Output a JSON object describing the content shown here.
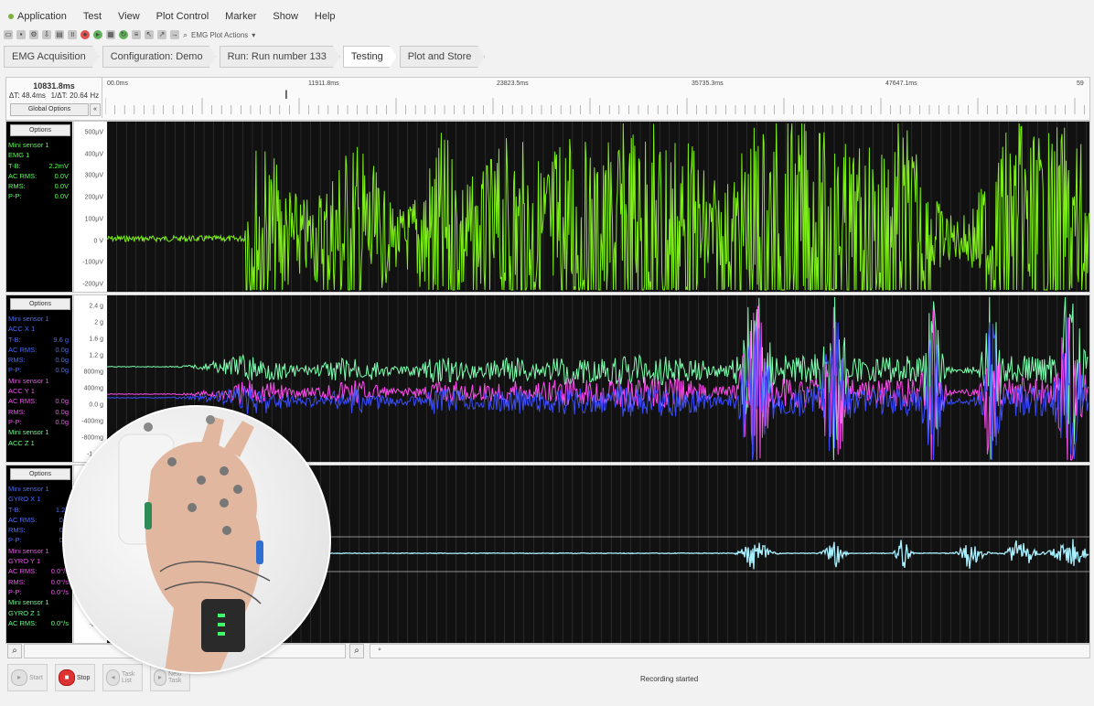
{
  "menu": {
    "items": [
      "Application",
      "Test",
      "View",
      "Plot Control",
      "Marker",
      "Show",
      "Help"
    ]
  },
  "toolbar": {
    "plot_actions_label": "EMG Plot Actions"
  },
  "breadcrumbs": [
    "EMG Acquisition",
    "Configuration: Demo",
    "Run: Run number 133",
    "Testing",
    "Plot and Store"
  ],
  "timeline": {
    "current_time": "10831.8ms",
    "delta_t": "ΔT: 48.4ms",
    "delta_f": "1/ΔT: 20.64 Hz",
    "global_options": "Global Options",
    "collapse": "«",
    "labels": [
      "00.0ms",
      "11911.8ms",
      "23823.5ms",
      "35735.3ms",
      "47647.1ms",
      "59"
    ]
  },
  "panels": [
    {
      "options": "Options",
      "lines": [
        {
          "label": "Mini sensor 1",
          "value": "",
          "color": "#55ff55"
        },
        {
          "label": "EMG 1",
          "value": "",
          "color": "#55ff55"
        },
        {
          "label": "T-B:",
          "value": "2.2mV",
          "color": "#55ff55"
        },
        {
          "label": "AC RMS:",
          "value": "0.0V",
          "color": "#55ff55"
        },
        {
          "label": "RMS:",
          "value": "0.0V",
          "color": "#55ff55"
        },
        {
          "label": "P-P:",
          "value": "0.0V",
          "color": "#55ff55"
        }
      ],
      "yticks": [
        "500μV",
        "400μV",
        "300μV",
        "200μV",
        "100μV",
        "0 V",
        "-100μV",
        "-200μV"
      ]
    },
    {
      "options": "Options",
      "lines": [
        {
          "label": "Mini sensor 1",
          "value": "",
          "color": "#4a6cff"
        },
        {
          "label": "ACC X 1",
          "value": "",
          "color": "#4a6cff"
        },
        {
          "label": "T-B:",
          "value": "9.6 g",
          "color": "#4a6cff"
        },
        {
          "label": "AC RMS:",
          "value": "0.0g",
          "color": "#4a6cff"
        },
        {
          "label": "RMS:",
          "value": "0.0g",
          "color": "#4a6cff"
        },
        {
          "label": "P-P:",
          "value": "0.0g",
          "color": "#4a6cff"
        },
        {
          "label": "Mini sensor 1",
          "value": "",
          "color": "#ee55ee"
        },
        {
          "label": "ACC Y 1",
          "value": "",
          "color": "#ee55ee"
        },
        {
          "label": "AC RMS:",
          "value": "0.0g",
          "color": "#ee55ee"
        },
        {
          "label": "RMS:",
          "value": "0.0g",
          "color": "#ee55ee"
        },
        {
          "label": "P-P:",
          "value": "0.0g",
          "color": "#ee55ee"
        },
        {
          "label": "Mini sensor 1",
          "value": "",
          "color": "#66ff88"
        },
        {
          "label": "ACC Z 1",
          "value": "",
          "color": "#66ff88"
        }
      ],
      "yticks": [
        "2.4 g",
        "2 g",
        "1.6 g",
        "1.2 g",
        "800mg",
        "400mg",
        "0.0 g",
        "-400mg",
        "-800mg",
        "-1.2 g"
      ]
    },
    {
      "options": "Options",
      "lines": [
        {
          "label": "Mini sensor 1",
          "value": "",
          "color": "#4a6cff"
        },
        {
          "label": "GYRO X 1",
          "value": "",
          "color": "#4a6cff"
        },
        {
          "label": "T-B:",
          "value": "1.2k",
          "color": "#4a6cff"
        },
        {
          "label": "AC RMS:",
          "value": "0.0",
          "color": "#4a6cff"
        },
        {
          "label": "RMS:",
          "value": "0.0",
          "color": "#4a6cff"
        },
        {
          "label": "P-P:",
          "value": "0.0",
          "color": "#4a6cff"
        },
        {
          "label": "Mini sensor 1",
          "value": "",
          "color": "#ee55ee"
        },
        {
          "label": "GYRO Y 1",
          "value": "",
          "color": "#ee55ee"
        },
        {
          "label": "AC RMS:",
          "value": "0.0°/s",
          "color": "#ee55ee"
        },
        {
          "label": "RMS:",
          "value": "0.0°/s",
          "color": "#ee55ee"
        },
        {
          "label": "P-P:",
          "value": "0.0°/s",
          "color": "#ee55ee"
        },
        {
          "label": "Mini sensor 1",
          "value": "",
          "color": "#66ff88"
        },
        {
          "label": "GYRO Z 1",
          "value": "",
          "color": "#66ff88"
        },
        {
          "label": "AC RMS:",
          "value": "0.0°/s",
          "color": "#66ff88"
        }
      ],
      "yticks": [
        "-2.5k"
      ]
    }
  ],
  "bottom": {
    "start": "Start",
    "stop": "Stop",
    "task_list": "Task List",
    "next_task": "Next Task",
    "status": "Recording started"
  },
  "colors": {
    "emg": "#7fef1a",
    "acc_x": "#3b4dff",
    "acc_y": "#ff4cf0",
    "acc_z": "#7dffb0",
    "gyro": "#a9f0ff"
  }
}
